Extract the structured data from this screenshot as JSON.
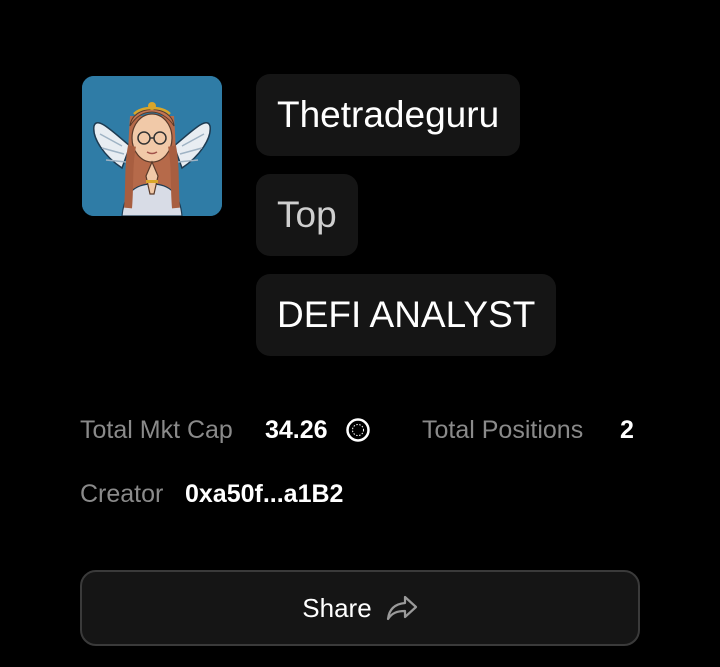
{
  "profile": {
    "name": "Thetradeguru",
    "rank": "Top",
    "title": "DEFI ANALYST",
    "avatar_icon": "angel-avatar-icon"
  },
  "stats": {
    "market_cap_label": "Total Mkt Cap",
    "market_cap_value": "34.26",
    "market_cap_icon": "coin-icon",
    "positions_label": "Total Positions",
    "positions_value": "2",
    "creator_label": "Creator",
    "creator_value": "0xa50f...a1B2"
  },
  "actions": {
    "share_label": "Share",
    "share_icon": "share-arrow-icon"
  },
  "colors": {
    "background": "#000000",
    "pill_background": "#151515",
    "label_gray": "#8a8a8a",
    "avatar_background": "#2f7ca6"
  }
}
